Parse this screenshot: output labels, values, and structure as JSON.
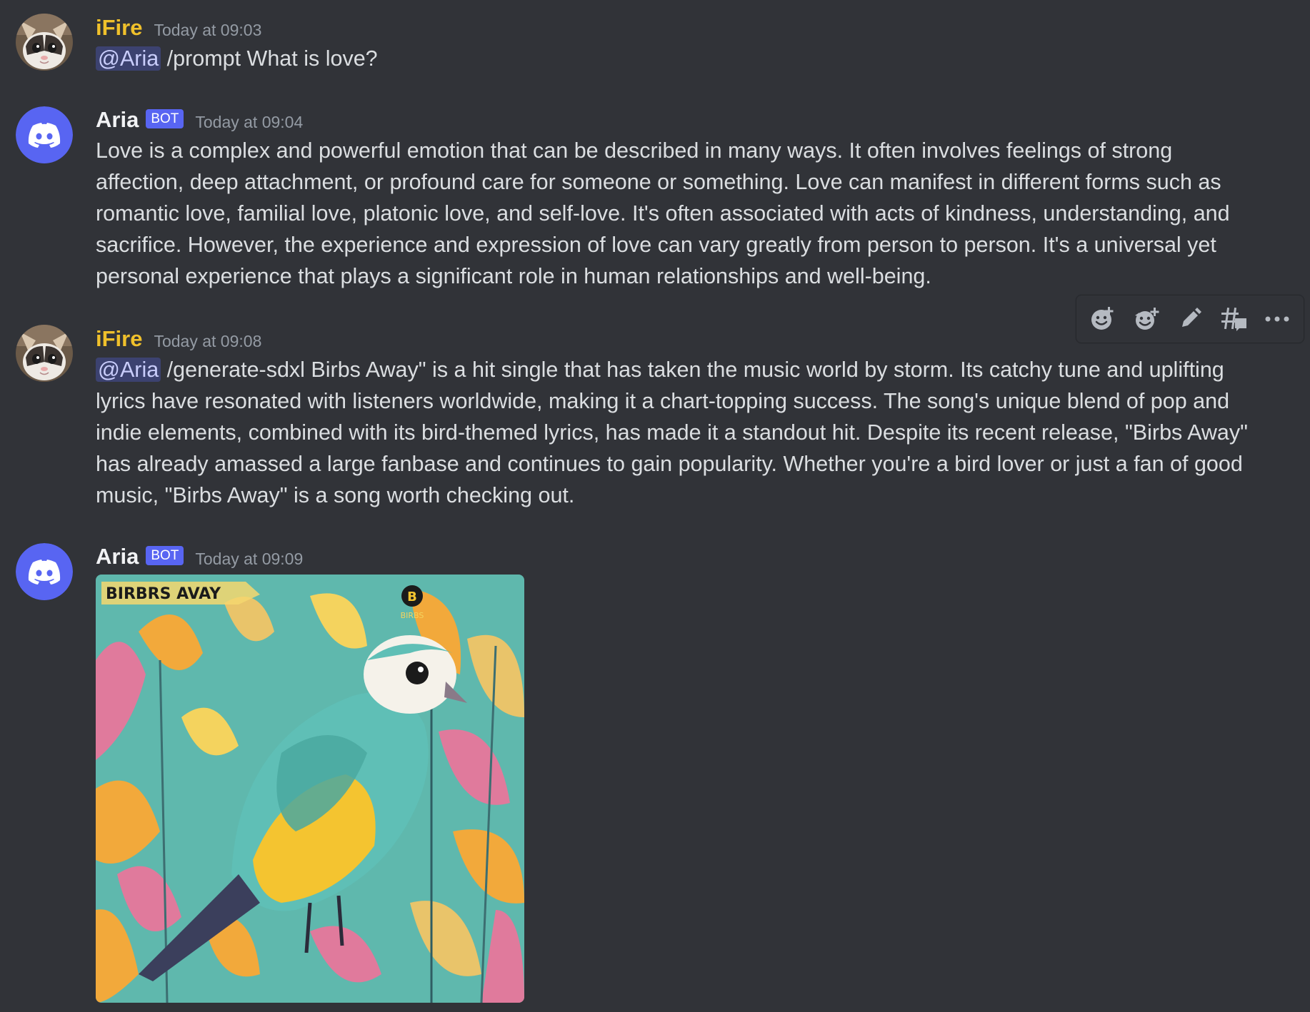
{
  "messages": [
    {
      "author": "iFire",
      "timestamp": "Today at 09:03",
      "mention": "@Aria",
      "text": " /prompt What is love?"
    },
    {
      "author": "Aria",
      "bot_tag": "BOT",
      "timestamp": "Today at 09:04",
      "text": "Love is a complex and powerful emotion that can be described in many ways. It often involves feelings of strong affection, deep attachment, or profound care for someone or something. Love can manifest in different forms such as romantic love, familial love, platonic love, and self-love. It's often associated with acts of kindness, understanding, and sacrifice. However, the experience and expression of love can vary greatly from person to person. It's a universal yet personal experience that plays a significant role in human relationships and well-being."
    },
    {
      "author": "iFire",
      "timestamp": "Today at 09:08",
      "mention": "@Aria",
      "text": " /generate-sdxl Birbs Away\" is a hit single that has taken the music world by storm. Its catchy tune and uplifting lyrics have resonated with listeners worldwide, making it a chart-topping success. The song's unique blend of pop and indie elements, combined with its bird-themed lyrics, has made it a standout hit. Despite its recent release, \"Birbs Away\" has already amassed a large fanbase and continues to gain popularity. Whether you're a bird lover or just a fan of good music, \"Birbs Away\" is a song worth checking out."
    },
    {
      "author": "Aria",
      "bot_tag": "BOT",
      "timestamp": "Today at 09:09",
      "attachment": {
        "title_text": "BIRBRS AVAY",
        "badge_letter": "B",
        "badge_caption": "BIRBS"
      }
    }
  ],
  "toolbar": {
    "icons": [
      "add-reaction-icon",
      "add-super-reaction-icon",
      "edit-icon",
      "create-thread-icon",
      "more-icon"
    ]
  },
  "colors": {
    "background": "#313338",
    "ifire_name": "#f0c12b",
    "bot_tag": "#5865f2",
    "mention_bg": "#3c4270",
    "discord_blurple": "#5865f2"
  }
}
